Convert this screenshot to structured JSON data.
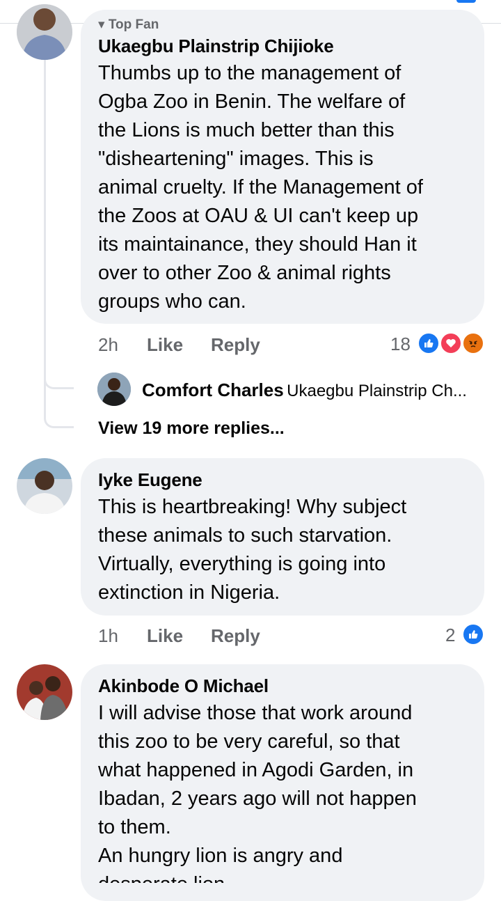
{
  "comments": [
    {
      "badge": "Top Fan",
      "name": "Ukaegbu Plainstrip Chijioke",
      "text": "Thumbs up to the management of\nOgba Zoo in Benin. The welfare of\nthe Lions is much better than this\n\"disheartening\" images. This is\nanimal cruelty. If the Management of\nthe Zoos at OAU & UI can't keep up\nits maintainance, they should Han it\nover to other Zoo & animal rights\ngroups who can.",
      "time": "2h",
      "like": "Like",
      "reply": "Reply",
      "reaction_count": "18",
      "reactions": [
        "like-reaction-icon",
        "love-reaction-icon",
        "angry-reaction-icon"
      ],
      "reply_preview": {
        "name": "Comfort Charles",
        "text": "Ukaegbu Plainstrip Ch..."
      },
      "more_replies": "View 19 more replies..."
    },
    {
      "name": "Iyke Eugene",
      "text": "This is heartbreaking! Why subject\nthese animals to such starvation.\nVirtually, everything is going into\nextinction in Nigeria.",
      "time": "1h",
      "like": "Like",
      "reply": "Reply",
      "reaction_count": "2",
      "reactions": [
        "like-reaction-icon"
      ]
    },
    {
      "name": "Akinbode O Michael",
      "text": "I will advise those that work around\nthis zoo to be very careful, so that\nwhat happened in Agodi Garden, in\nIbadan, 2 years ago will not happen\nto them.\nAn hungry lion is angry and\ndesperate lion."
    }
  ],
  "colors": {
    "bubble": "#f0f2f5",
    "meta_text": "#65676b",
    "like_blue": "#1877f2",
    "love_red": "#f33e58",
    "angry_orange": "#e9710f"
  }
}
